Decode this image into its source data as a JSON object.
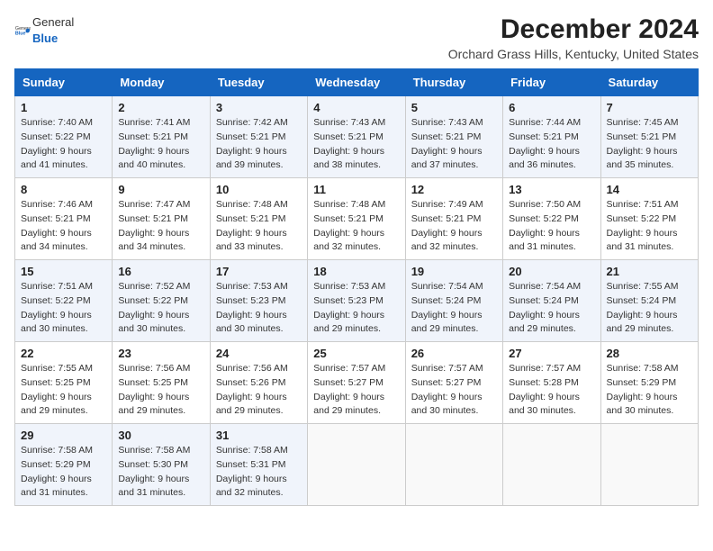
{
  "logo": {
    "general": "General",
    "blue": "Blue"
  },
  "title": "December 2024",
  "subtitle": "Orchard Grass Hills, Kentucky, United States",
  "days_of_week": [
    "Sunday",
    "Monday",
    "Tuesday",
    "Wednesday",
    "Thursday",
    "Friday",
    "Saturday"
  ],
  "weeks": [
    [
      {
        "day": "1",
        "sunrise": "7:40 AM",
        "sunset": "5:22 PM",
        "daylight": "9 hours and 41 minutes."
      },
      {
        "day": "2",
        "sunrise": "7:41 AM",
        "sunset": "5:21 PM",
        "daylight": "9 hours and 40 minutes."
      },
      {
        "day": "3",
        "sunrise": "7:42 AM",
        "sunset": "5:21 PM",
        "daylight": "9 hours and 39 minutes."
      },
      {
        "day": "4",
        "sunrise": "7:43 AM",
        "sunset": "5:21 PM",
        "daylight": "9 hours and 38 minutes."
      },
      {
        "day": "5",
        "sunrise": "7:43 AM",
        "sunset": "5:21 PM",
        "daylight": "9 hours and 37 minutes."
      },
      {
        "day": "6",
        "sunrise": "7:44 AM",
        "sunset": "5:21 PM",
        "daylight": "9 hours and 36 minutes."
      },
      {
        "day": "7",
        "sunrise": "7:45 AM",
        "sunset": "5:21 PM",
        "daylight": "9 hours and 35 minutes."
      }
    ],
    [
      {
        "day": "8",
        "sunrise": "7:46 AM",
        "sunset": "5:21 PM",
        "daylight": "9 hours and 34 minutes."
      },
      {
        "day": "9",
        "sunrise": "7:47 AM",
        "sunset": "5:21 PM",
        "daylight": "9 hours and 34 minutes."
      },
      {
        "day": "10",
        "sunrise": "7:48 AM",
        "sunset": "5:21 PM",
        "daylight": "9 hours and 33 minutes."
      },
      {
        "day": "11",
        "sunrise": "7:48 AM",
        "sunset": "5:21 PM",
        "daylight": "9 hours and 32 minutes."
      },
      {
        "day": "12",
        "sunrise": "7:49 AM",
        "sunset": "5:21 PM",
        "daylight": "9 hours and 32 minutes."
      },
      {
        "day": "13",
        "sunrise": "7:50 AM",
        "sunset": "5:22 PM",
        "daylight": "9 hours and 31 minutes."
      },
      {
        "day": "14",
        "sunrise": "7:51 AM",
        "sunset": "5:22 PM",
        "daylight": "9 hours and 31 minutes."
      }
    ],
    [
      {
        "day": "15",
        "sunrise": "7:51 AM",
        "sunset": "5:22 PM",
        "daylight": "9 hours and 30 minutes."
      },
      {
        "day": "16",
        "sunrise": "7:52 AM",
        "sunset": "5:22 PM",
        "daylight": "9 hours and 30 minutes."
      },
      {
        "day": "17",
        "sunrise": "7:53 AM",
        "sunset": "5:23 PM",
        "daylight": "9 hours and 30 minutes."
      },
      {
        "day": "18",
        "sunrise": "7:53 AM",
        "sunset": "5:23 PM",
        "daylight": "9 hours and 29 minutes."
      },
      {
        "day": "19",
        "sunrise": "7:54 AM",
        "sunset": "5:24 PM",
        "daylight": "9 hours and 29 minutes."
      },
      {
        "day": "20",
        "sunrise": "7:54 AM",
        "sunset": "5:24 PM",
        "daylight": "9 hours and 29 minutes."
      },
      {
        "day": "21",
        "sunrise": "7:55 AM",
        "sunset": "5:24 PM",
        "daylight": "9 hours and 29 minutes."
      }
    ],
    [
      {
        "day": "22",
        "sunrise": "7:55 AM",
        "sunset": "5:25 PM",
        "daylight": "9 hours and 29 minutes."
      },
      {
        "day": "23",
        "sunrise": "7:56 AM",
        "sunset": "5:25 PM",
        "daylight": "9 hours and 29 minutes."
      },
      {
        "day": "24",
        "sunrise": "7:56 AM",
        "sunset": "5:26 PM",
        "daylight": "9 hours and 29 minutes."
      },
      {
        "day": "25",
        "sunrise": "7:57 AM",
        "sunset": "5:27 PM",
        "daylight": "9 hours and 29 minutes."
      },
      {
        "day": "26",
        "sunrise": "7:57 AM",
        "sunset": "5:27 PM",
        "daylight": "9 hours and 30 minutes."
      },
      {
        "day": "27",
        "sunrise": "7:57 AM",
        "sunset": "5:28 PM",
        "daylight": "9 hours and 30 minutes."
      },
      {
        "day": "28",
        "sunrise": "7:58 AM",
        "sunset": "5:29 PM",
        "daylight": "9 hours and 30 minutes."
      }
    ],
    [
      {
        "day": "29",
        "sunrise": "7:58 AM",
        "sunset": "5:29 PM",
        "daylight": "9 hours and 31 minutes."
      },
      {
        "day": "30",
        "sunrise": "7:58 AM",
        "sunset": "5:30 PM",
        "daylight": "9 hours and 31 minutes."
      },
      {
        "day": "31",
        "sunrise": "7:58 AM",
        "sunset": "5:31 PM",
        "daylight": "9 hours and 32 minutes."
      },
      null,
      null,
      null,
      null
    ]
  ]
}
